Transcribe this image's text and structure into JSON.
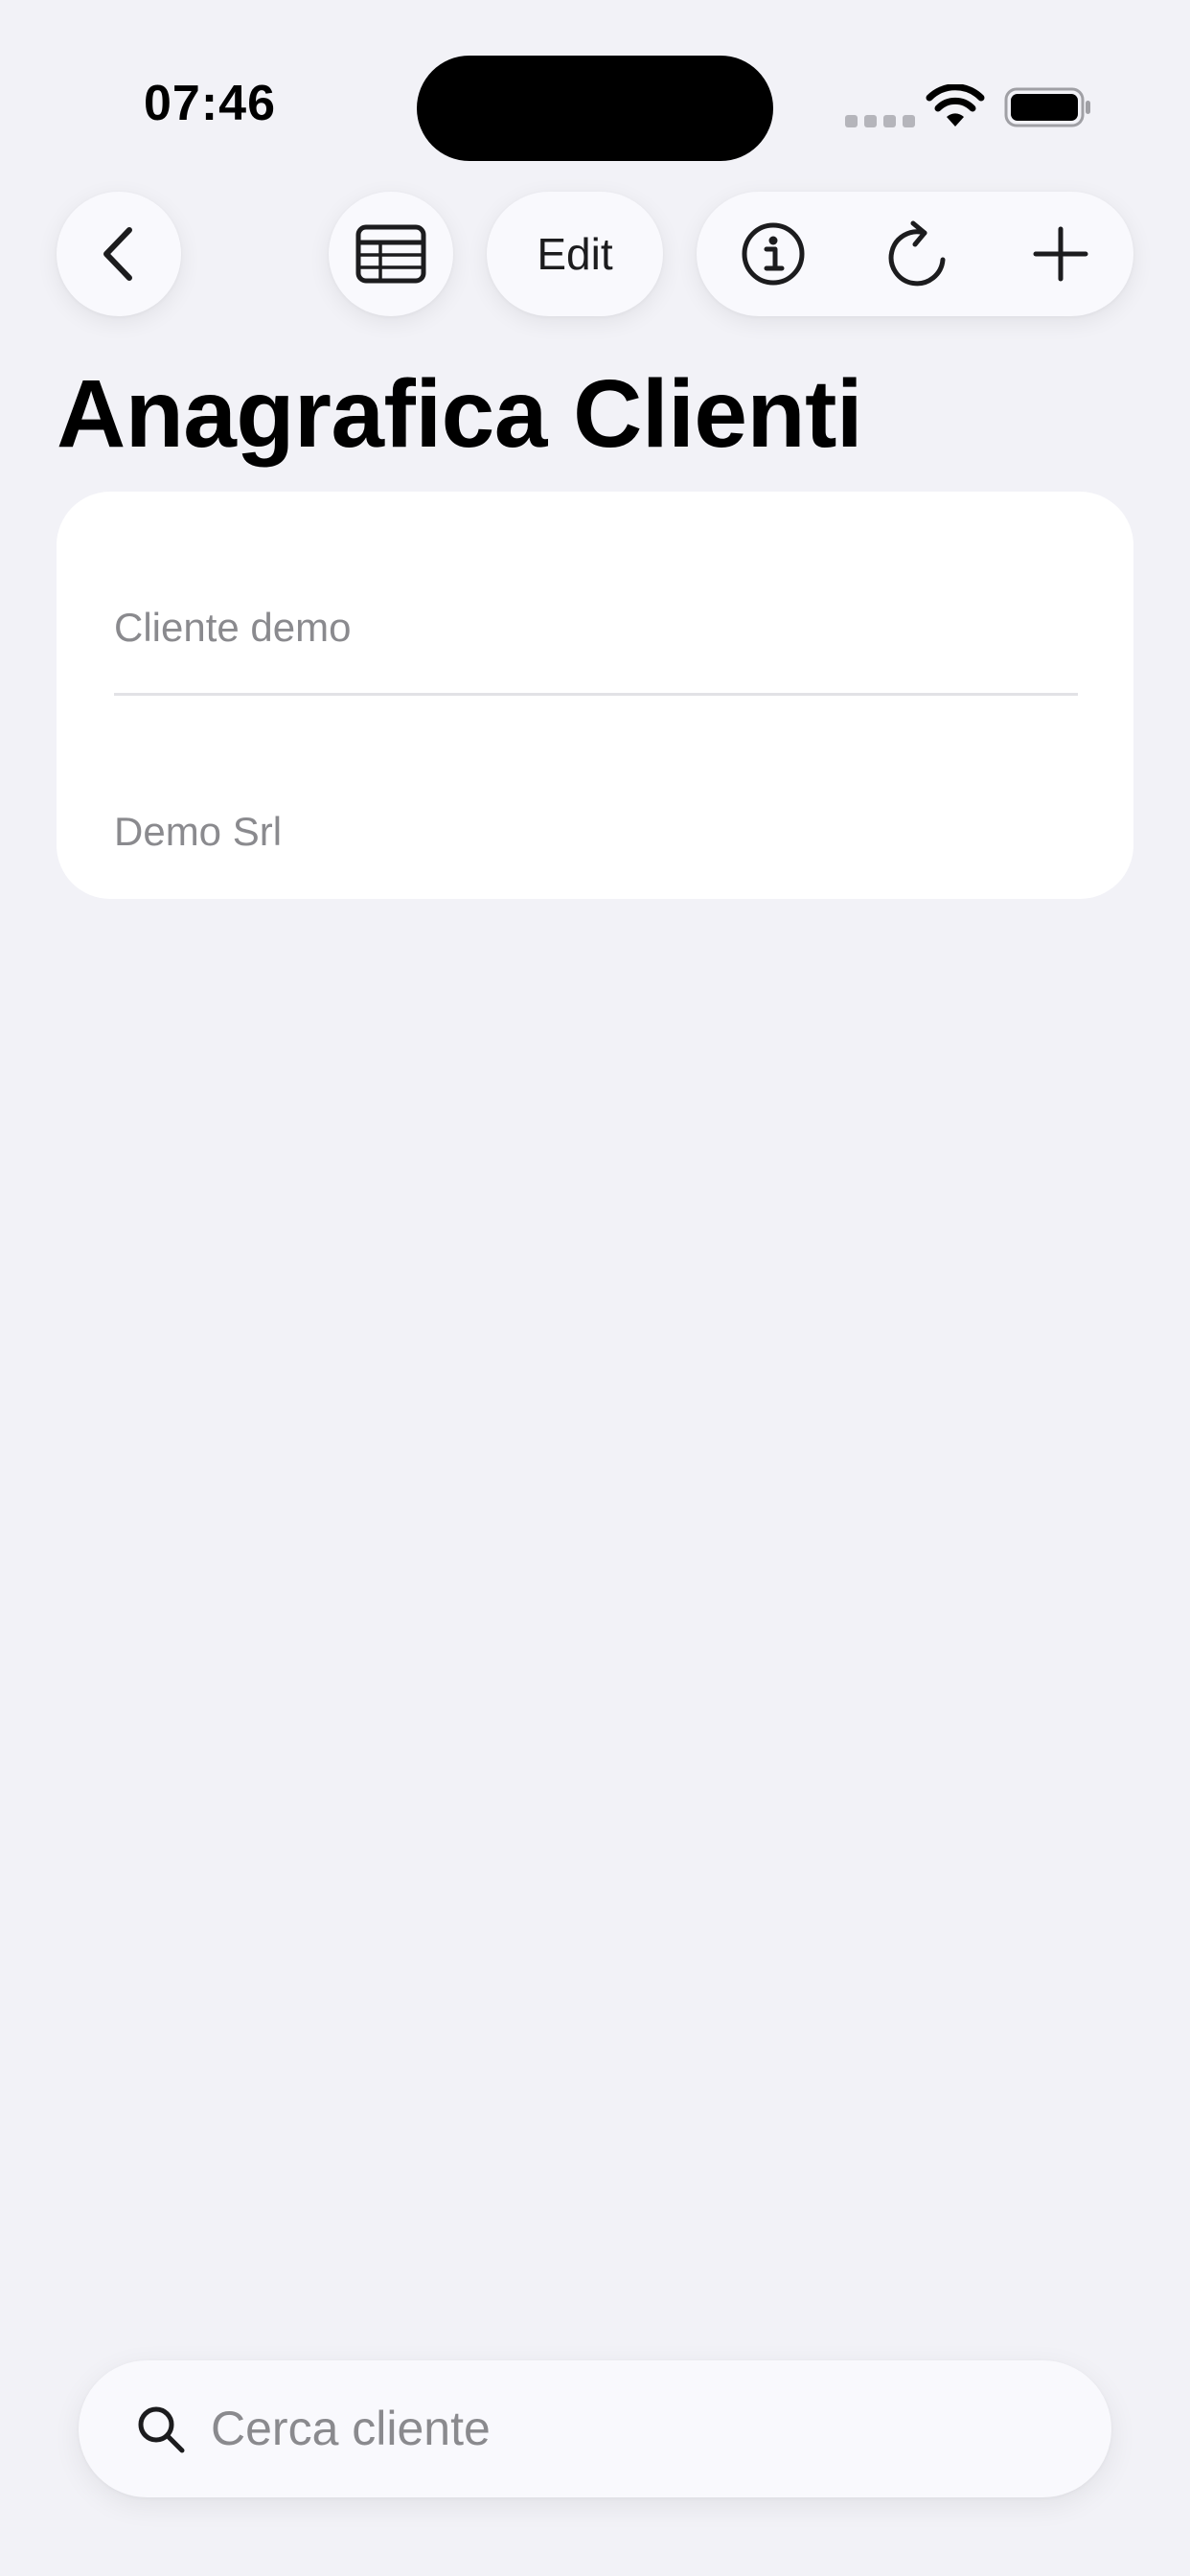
{
  "status_bar": {
    "time": "07:46",
    "icons": [
      "cellular-signal-icon",
      "wifi-icon",
      "battery-icon"
    ]
  },
  "nav": {
    "back_icon": "chevron-left-icon",
    "table_icon": "table-icon",
    "edit_label": "Edit",
    "info_icon": "info-icon",
    "refresh_icon": "refresh-icon",
    "add_icon": "plus-icon"
  },
  "page": {
    "title": "Anagrafica Clienti"
  },
  "clients": [
    {
      "name": "Cliente demo"
    },
    {
      "name": "Demo Srl"
    }
  ],
  "search": {
    "placeholder": "Cerca cliente",
    "value": "",
    "icon": "search-icon"
  },
  "colors": {
    "background": "#f2f2f7",
    "card": "#ffffff",
    "button": "#f9f9fd",
    "secondary_text": "#8a8a8e"
  }
}
